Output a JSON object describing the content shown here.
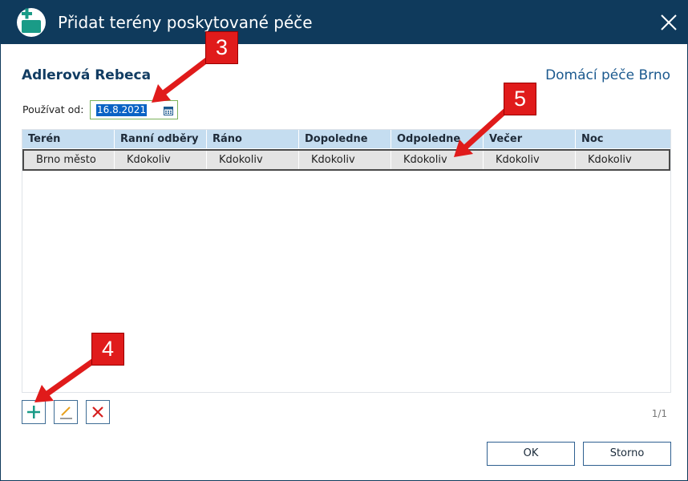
{
  "window": {
    "title": "Přidat terény poskytované péče"
  },
  "header": {
    "patient_name": "Adlerová Rebeca",
    "provider_name": "Domácí péče Brno"
  },
  "date_field": {
    "label": "Používat od:",
    "value": "16.8.2021"
  },
  "grid": {
    "columns": [
      "Terén",
      "Ranní odběry",
      "Ráno",
      "Dopoledne",
      "Odpoledne",
      "Večer",
      "Noc"
    ],
    "rows": [
      [
        "Brno město",
        "Kdokoliv",
        "Kdokoliv",
        "Kdokoliv",
        "Kdokoliv",
        "Kdokoliv",
        "Kdokoliv"
      ]
    ]
  },
  "toolbar": {
    "add_icon": "plus-icon",
    "edit_icon": "pencil-icon",
    "delete_icon": "x-icon"
  },
  "pagination": {
    "text": "1/1"
  },
  "buttons": {
    "ok": "OK",
    "cancel": "Storno"
  },
  "annotations": {
    "callout_3": "3",
    "callout_4": "4",
    "callout_5": "5"
  },
  "colors": {
    "titlebar": "#0f3a5c",
    "accent": "#1a9b87",
    "grid_header": "#c5ddf0",
    "callout": "#e01b1b"
  }
}
